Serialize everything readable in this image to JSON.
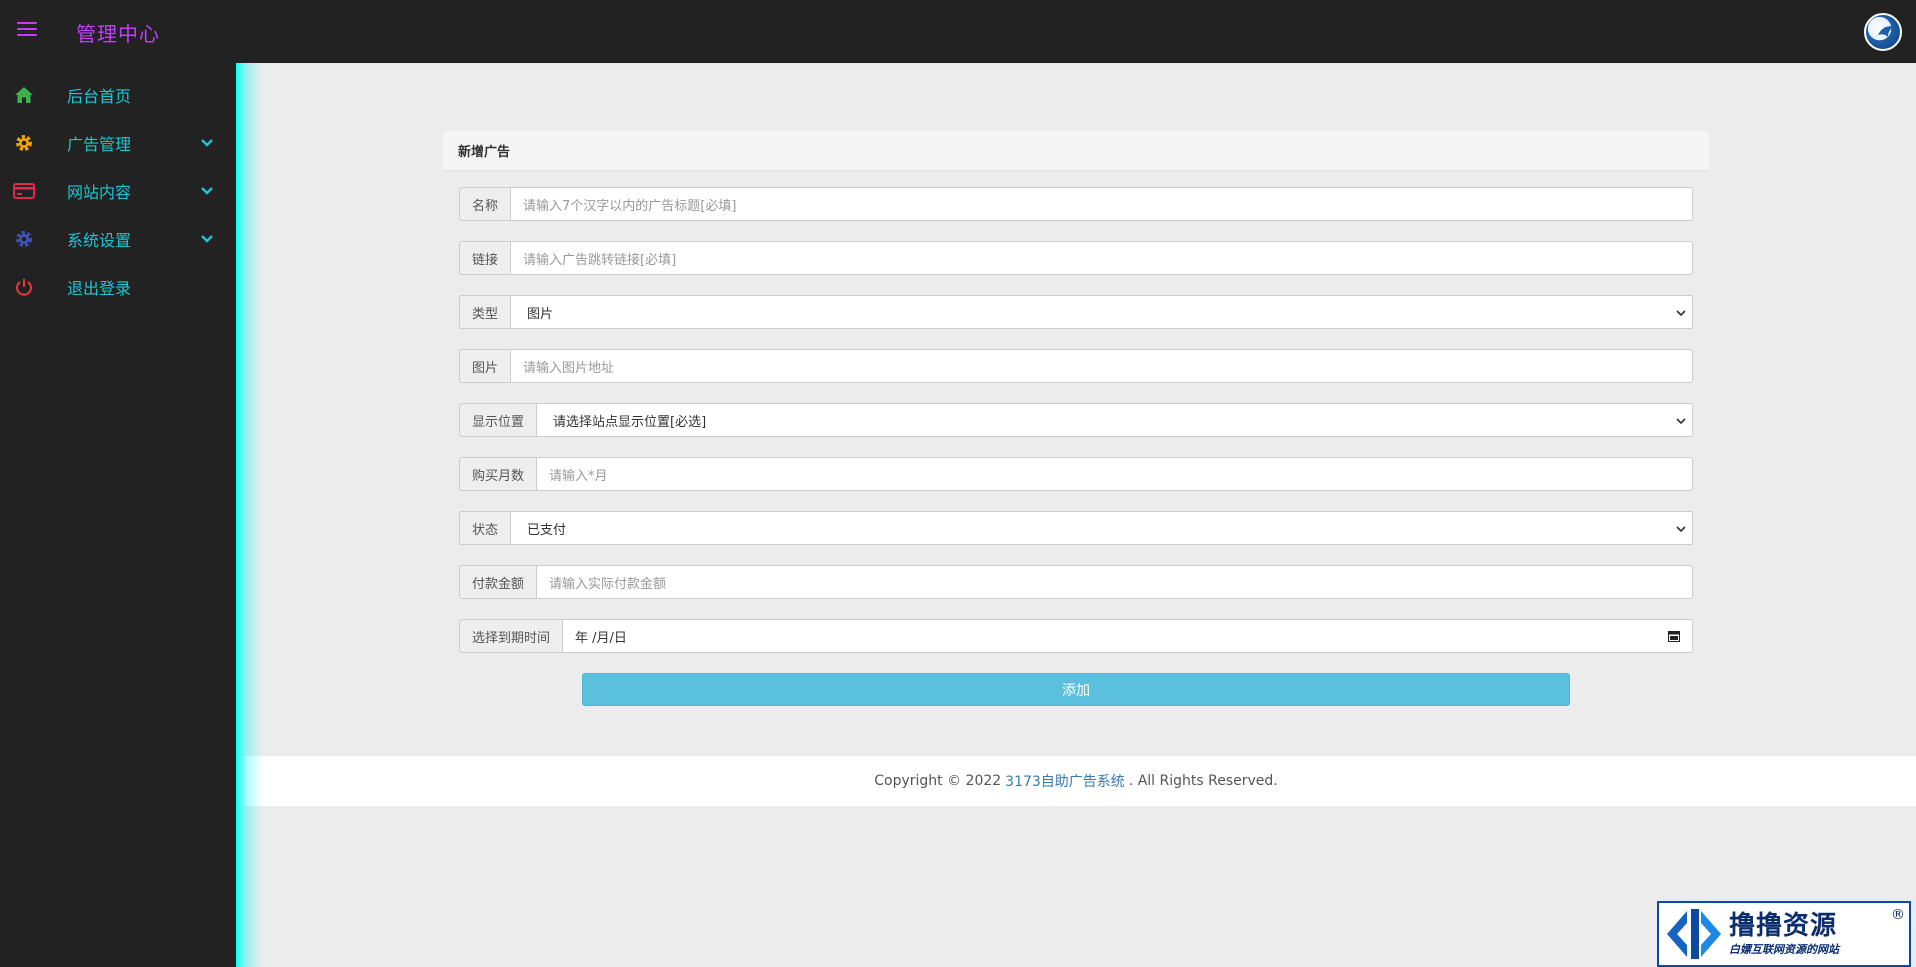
{
  "header": {
    "brand": "管理中心"
  },
  "sidebar": {
    "items": [
      {
        "label": "后台首页",
        "icon": "home-icon",
        "color": "#3cb34a"
      },
      {
        "label": "广告管理",
        "icon": "gear-icon",
        "color": "#f0a30a"
      },
      {
        "label": "网站内容",
        "icon": "card-icon",
        "color": "#e8254f"
      },
      {
        "label": "系统设置",
        "icon": "gear-icon",
        "color": "#3f51b5"
      },
      {
        "label": "退出登录",
        "icon": "power-icon",
        "color": "#e53935"
      }
    ]
  },
  "panel": {
    "title": "新增广告"
  },
  "form": {
    "name": {
      "label": "名称",
      "placeholder": "请输入7个汉字以内的广告标题[必填]"
    },
    "link": {
      "label": "链接",
      "placeholder": "请输入广告跳转链接[必填]"
    },
    "type": {
      "label": "类型",
      "value": "图片"
    },
    "image": {
      "label": "图片",
      "placeholder": "请输入图片地址"
    },
    "position": {
      "label": "显示位置",
      "value": "请选择站点显示位置[必选]"
    },
    "months": {
      "label": "购买月数",
      "placeholder": "请输入*月"
    },
    "status": {
      "label": "状态",
      "value": "已支付"
    },
    "amount": {
      "label": "付款金额",
      "placeholder": "请输入实际付款金额"
    },
    "expire": {
      "label": "选择到期时间",
      "value": "年 /月/日"
    },
    "submit": "添加"
  },
  "footer": {
    "prefix": "Copyright © 2022",
    "link": "3173自助广告系统",
    "suffix": ". All Rights Reserved."
  },
  "watermark": {
    "title": "撸撸资源",
    "subtitle": "白嫖互联网资源的网站",
    "reg": "®"
  },
  "colors": {
    "accent": "#c63cff",
    "sidebar_text": "#19c8d2",
    "glow": "#00fff0",
    "button": "#5bc0de"
  }
}
